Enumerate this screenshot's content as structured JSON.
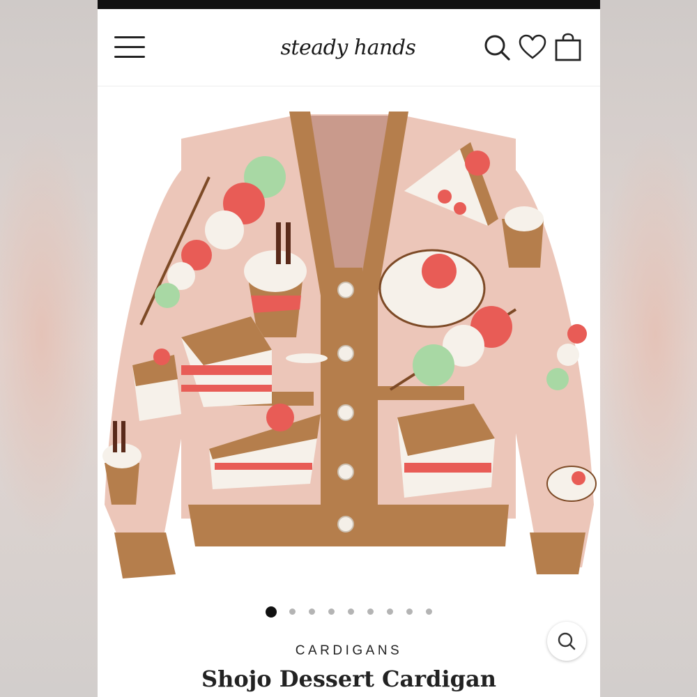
{
  "header": {
    "logo_text": "steady hands",
    "icons": [
      "menu-icon",
      "search-icon",
      "heart-icon",
      "shopping-bag-icon"
    ]
  },
  "gallery": {
    "image_count": 9,
    "active_index": 0,
    "zoom_icon": "magnifier-icon"
  },
  "product": {
    "category": "CARDIGANS",
    "title": "Shojo Dessert Cardigan"
  },
  "colors": {
    "statusbar": "#111111",
    "knit_pink": "#ecc6b9",
    "trim_brown": "#b57e4c",
    "accent_red": "#e85c56",
    "accent_green": "#a8d8a4",
    "cream": "#f6f1ea",
    "brown_dark": "#7d4a26"
  }
}
